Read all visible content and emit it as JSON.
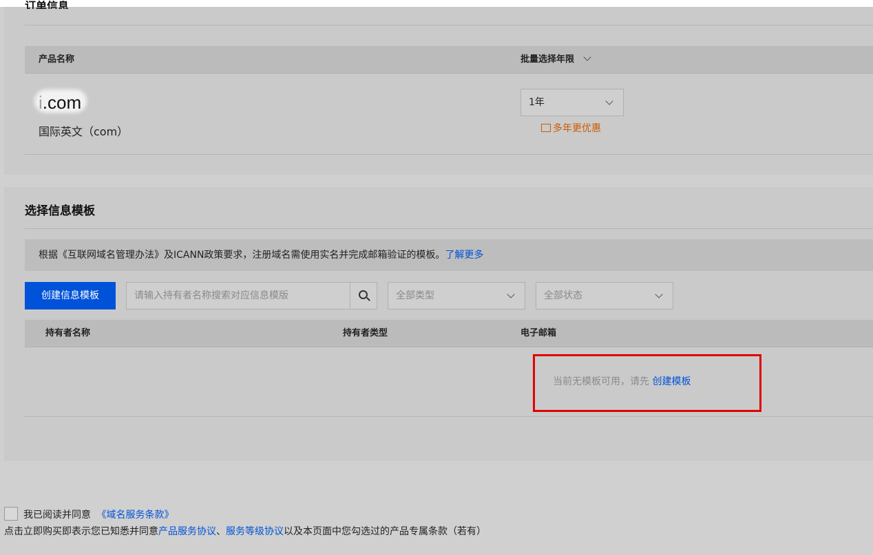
{
  "order": {
    "title": "订单信息",
    "columns": {
      "product": "产品名称",
      "years": "批量选择年限"
    },
    "item": {
      "domain_suffix": ".com",
      "domain_prefix_fragment": "i",
      "type": "国际英文（com）",
      "years_value": "1年",
      "promo": "多年更优惠"
    }
  },
  "template": {
    "title": "选择信息模板",
    "notice": "根据《互联网域名管理办法》及ICANN政策要求，注册域名需使用实名并完成邮箱验证的模板。",
    "learn_more": "了解更多",
    "create_button": "创建信息模板",
    "search_placeholder": "请输入持有者名称搜索对应信息模版",
    "type_filter": "全部类型",
    "status_filter": "全部状态",
    "columns": {
      "holder": "持有者名称",
      "holder_type": "持有者类型",
      "email": "电子邮箱"
    },
    "empty_text": "当前无模板可用，请先",
    "empty_link": "创建模板"
  },
  "footer": {
    "agree_text": "我已阅读并同意",
    "agree_link": "《域名服务条款》",
    "legal_prefix": "点击立即购买即表示您已知悉并同意",
    "legal_link1": "产品服务协议",
    "legal_sep": "、",
    "legal_link2": "服务等级协议",
    "legal_suffix": "以及本页面中您勾选过的产品专属条款（若有）"
  },
  "colors": {
    "accent": "#0052d9",
    "promo": "#cc5a00",
    "highlight": "#e00000"
  }
}
